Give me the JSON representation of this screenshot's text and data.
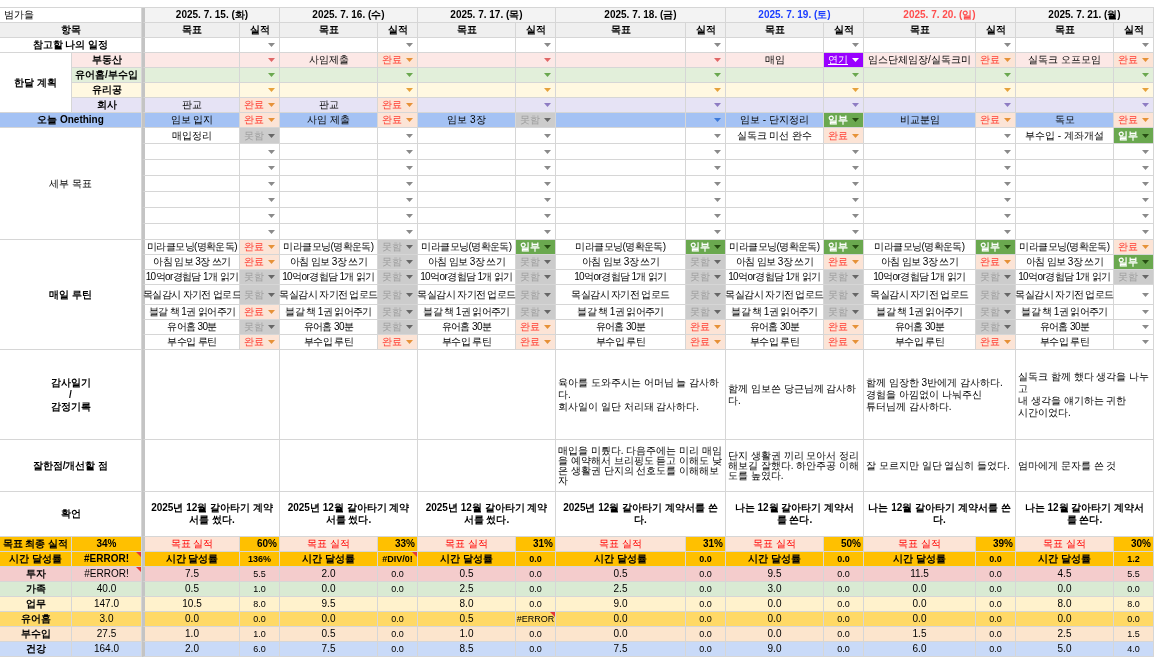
{
  "sheet": {
    "title": "범가을",
    "item_header": "항목",
    "reference_label": "참고할 나의 일정",
    "monthly_label": "한달 계획",
    "onething_label": "오늘 Onething",
    "details_label": "세부 목표",
    "routine_label": "매일 루틴",
    "gratitude_label": "감사일기\n/\n감정기록",
    "review_label": "잘한점/개선할 점",
    "affirmation_label": "확언"
  },
  "monthly_categories": [
    {
      "label": "부동산",
      "color": "#fce8e6",
      "arrow": {
        "color": "#e06666"
      }
    },
    {
      "label": "유어홈/부수입",
      "color": "#e2efda",
      "arrow": {
        "color": "#6aa84f"
      }
    },
    {
      "label": "유리공",
      "color": "#fff8e1",
      "arrow": {
        "color": "#e6a23c"
      }
    },
    {
      "label": "회사",
      "color": "#e6e3f5",
      "arrow": {
        "color": "#8e7cc3"
      }
    }
  ],
  "summary": {
    "rate_label": "목표 최종 실적",
    "rate": "34%",
    "time_label": "시간 달성률",
    "time_rate": "#ERROR!",
    "time_note": true
  },
  "summary_categories": [
    {
      "label": "투자",
      "color": "#f4cccc",
      "total": "#ERROR!",
      "note": true
    },
    {
      "label": "가족",
      "color": "#d9ead3",
      "total": "40.0",
      "note": false
    },
    {
      "label": "업무",
      "color": "#fff2cc",
      "total": "147.0",
      "note": false
    },
    {
      "label": "유어홈",
      "color": "#ffd966",
      "total": "3.0",
      "note": false
    },
    {
      "label": "부수입",
      "color": "#fce5cd",
      "total": "27.5",
      "note": false
    },
    {
      "label": "건강",
      "color": "#c9daf8",
      "total": "164.0",
      "note": false
    }
  ],
  "days": [
    {
      "date": "2025. 7. 15. (화)",
      "color": "#000000",
      "goal_header": "목표",
      "result_header": "실적",
      "reference": {
        "result": {
          "kind": "empty"
        }
      },
      "monthly": [
        {
          "result": {
            "kind": "empty"
          }
        },
        {
          "result": {
            "kind": "empty"
          }
        },
        {
          "result": {
            "kind": "empty"
          }
        },
        {
          "goal": "판교",
          "result": {
            "kind": "done",
            "label": "완료"
          }
        }
      ],
      "onething": {
        "goal": "임보 입지",
        "result": {
          "kind": "done",
          "label": "완료"
        }
      },
      "details": [
        {
          "goal": "매입정리",
          "result": {
            "kind": "fail",
            "label": "못함"
          }
        },
        {
          "result": {
            "kind": "empty"
          }
        },
        {
          "result": {
            "kind": "empty"
          }
        },
        {
          "result": {
            "kind": "empty"
          }
        },
        {
          "result": {
            "kind": "empty"
          }
        },
        {
          "result": {
            "kind": "empty"
          }
        },
        {
          "result": {
            "kind": "empty"
          }
        }
      ],
      "routine": [
        {
          "goal": "미라클모닝(명확운독)",
          "result": {
            "kind": "done",
            "label": "완료"
          }
        },
        {
          "goal": "아침 임보 3장 쓰기",
          "result": {
            "kind": "done",
            "label": "완료"
          }
        },
        {
          "goal": "10억or경험담 1개 읽기",
          "result": {
            "kind": "fail",
            "label": "못함"
          }
        },
        {
          "goal": "목실감시 자기전 업로드",
          "result": {
            "kind": "fail",
            "label": "못함"
          }
        },
        {
          "goal": "블갈 책 1권 읽어주기",
          "result": {
            "kind": "done",
            "label": "완료"
          }
        },
        {
          "goal": "유어홈 30분",
          "result": {
            "kind": "fail",
            "label": "못함"
          }
        },
        {
          "goal": "부수입 루틴",
          "result": {
            "kind": "done",
            "label": "완료"
          }
        }
      ],
      "affirmation": "2025년 12월 갈아타기 계약서를 썼다.",
      "rate_label": "목표 실적",
      "rate": "60%",
      "time_label": "시간 달성률",
      "time_rate": "136%",
      "time_note": false,
      "hours": [
        {
          "goal": "7.5",
          "result": "5.5",
          "note": false
        },
        {
          "goal": "0.5",
          "result": "1.0",
          "note": false
        },
        {
          "goal": "10.5",
          "result": "8.0",
          "note": false
        },
        {
          "goal": "0.0",
          "result": "0.0",
          "note": false
        },
        {
          "goal": "1.0",
          "result": "1.0",
          "note": false
        },
        {
          "goal": "2.0",
          "result": "6.0",
          "note": false
        }
      ]
    },
    {
      "date": "2025. 7. 16. (수)",
      "color": "#000000",
      "goal_header": "목표",
      "result_header": "실적",
      "reference": {
        "result": {
          "kind": "empty"
        }
      },
      "monthly": [
        {
          "goal": "사임제출",
          "result": {
            "kind": "done",
            "label": "완료"
          }
        },
        {
          "result": {
            "kind": "empty"
          }
        },
        {
          "result": {
            "kind": "empty"
          }
        },
        {
          "goal": "판교",
          "result": {
            "kind": "done",
            "label": "완료"
          }
        }
      ],
      "onething": {
        "goal": "사임 제출",
        "result": {
          "kind": "done",
          "label": "완료"
        }
      },
      "details": [
        {
          "result": {
            "kind": "empty"
          }
        },
        {
          "result": {
            "kind": "empty"
          }
        },
        {
          "result": {
            "kind": "empty"
          }
        },
        {
          "result": {
            "kind": "empty"
          }
        },
        {
          "result": {
            "kind": "empty"
          }
        },
        {
          "result": {
            "kind": "empty"
          }
        },
        {
          "result": {
            "kind": "empty"
          }
        }
      ],
      "routine": [
        {
          "goal": "미라클모닝(명확운독)",
          "result": {
            "kind": "fail",
            "label": "못함"
          }
        },
        {
          "goal": "아침 임보 3장 쓰기",
          "result": {
            "kind": "fail",
            "label": "못함"
          }
        },
        {
          "goal": "10억or경험담 1개 읽기",
          "result": {
            "kind": "fail",
            "label": "못함"
          }
        },
        {
          "goal": "목실감시 자기전 업로드",
          "result": {
            "kind": "fail",
            "label": "못함"
          }
        },
        {
          "goal": "블갈 책 1권 읽어주기",
          "result": {
            "kind": "fail",
            "label": "못함"
          }
        },
        {
          "goal": "유어홈 30분",
          "result": {
            "kind": "fail",
            "label": "못함"
          }
        },
        {
          "goal": "부수입 루틴",
          "result": {
            "kind": "done",
            "label": "완료"
          }
        }
      ],
      "affirmation": "2025년 12월 갈아타기 계약서를 썼다.",
      "rate_label": "목표 실적",
      "rate": "33%",
      "time_label": "시간 달성률",
      "time_rate": "#DIV/0!",
      "time_note": true,
      "hours": [
        {
          "goal": "2.0",
          "result": "0.0",
          "note": false
        },
        {
          "goal": "0.0",
          "result": "0.0",
          "note": false
        },
        {
          "goal": "9.5",
          "note": false
        },
        {
          "goal": "0.0",
          "result": "0.0",
          "note": false
        },
        {
          "goal": "0.5",
          "result": "0.0",
          "note": false
        },
        {
          "goal": "7.5",
          "result": "0.0",
          "note": false
        }
      ]
    },
    {
      "date": "2025. 7. 17. (목)",
      "color": "#000000",
      "goal_header": "목표",
      "result_header": "실적",
      "reference": {
        "result": {
          "kind": "empty"
        }
      },
      "monthly": [
        {
          "result": {
            "kind": "empty"
          }
        },
        {
          "result": {
            "kind": "empty"
          }
        },
        {
          "result": {
            "kind": "empty"
          }
        },
        {
          "result": {
            "kind": "empty"
          }
        }
      ],
      "onething": {
        "goal": "임보 3장",
        "result": {
          "kind": "fail",
          "label": "못함"
        }
      },
      "details": [
        {
          "result": {
            "kind": "empty"
          }
        },
        {
          "result": {
            "kind": "empty"
          }
        },
        {
          "result": {
            "kind": "empty"
          }
        },
        {
          "result": {
            "kind": "empty"
          }
        },
        {
          "result": {
            "kind": "empty"
          }
        },
        {
          "result": {
            "kind": "empty"
          }
        },
        {
          "result": {
            "kind": "empty"
          }
        }
      ],
      "routine": [
        {
          "goal": "미라클모닝(명확운독)",
          "result": {
            "kind": "partial",
            "label": "일부"
          }
        },
        {
          "goal": "아침 임보 3장 쓰기",
          "result": {
            "kind": "fail",
            "label": "못함"
          }
        },
        {
          "goal": "10억or경험담 1개 읽기",
          "result": {
            "kind": "fail",
            "label": "못함"
          }
        },
        {
          "goal": "목실감시 자기전 업로드",
          "result": {
            "kind": "fail",
            "label": "못함"
          }
        },
        {
          "goal": "블갈 책 1권 읽어주기",
          "result": {
            "kind": "fail",
            "label": "못함"
          }
        },
        {
          "goal": "유어홈 30분",
          "result": {
            "kind": "done",
            "label": "완료"
          }
        },
        {
          "goal": "부수입 루틴",
          "result": {
            "kind": "done",
            "label": "완료"
          }
        }
      ],
      "affirmation": "2025년 12월 갈아타기 계약서를 썼다.",
      "rate_label": "목표 실적",
      "rate": "31%",
      "time_label": "시간 달성률",
      "time_rate": "0.0",
      "time_note": false,
      "hours": [
        {
          "goal": "0.5",
          "result": "0.0",
          "note": false
        },
        {
          "goal": "2.5",
          "result": "0.0",
          "note": false
        },
        {
          "goal": "8.0",
          "result": "0.0",
          "note": false
        },
        {
          "goal": "0.5",
          "result": "#ERROR",
          "note": true
        },
        {
          "goal": "1.0",
          "result": "0.0",
          "note": false
        },
        {
          "goal": "8.5",
          "result": "0.0",
          "note": false
        }
      ]
    },
    {
      "date": "2025. 7. 18. (금)",
      "color": "#000000",
      "goal_header": "목표",
      "result_header": "실적",
      "reference": {
        "result": {
          "kind": "empty"
        }
      },
      "monthly": [
        {
          "result": {
            "kind": "empty"
          }
        },
        {
          "result": {
            "kind": "empty"
          }
        },
        {
          "result": {
            "kind": "empty"
          }
        },
        {
          "result": {
            "kind": "empty"
          }
        }
      ],
      "onething": {
        "result": {
          "kind": "empty"
        }
      },
      "details": [
        {
          "result": {
            "kind": "empty"
          }
        },
        {
          "result": {
            "kind": "empty"
          }
        },
        {
          "result": {
            "kind": "empty"
          }
        },
        {
          "result": {
            "kind": "empty"
          }
        },
        {
          "result": {
            "kind": "empty"
          }
        },
        {
          "result": {
            "kind": "empty"
          }
        },
        {
          "result": {
            "kind": "empty"
          }
        }
      ],
      "routine": [
        {
          "goal": "미라클모닝(명확운독)",
          "result": {
            "kind": "partial",
            "label": "일부"
          }
        },
        {
          "goal": "아침 임보 3장 쓰기",
          "result": {
            "kind": "fail",
            "label": "못함"
          }
        },
        {
          "goal": "10억or경험담 1개 읽기",
          "result": {
            "kind": "fail",
            "label": "못함"
          }
        },
        {
          "goal": "목실감시 자기전 업로드",
          "result": {
            "kind": "fail",
            "label": "못함"
          }
        },
        {
          "goal": "블갈 책 1권 읽어주기",
          "result": {
            "kind": "fail",
            "label": "못함"
          }
        },
        {
          "goal": "유어홈 30분",
          "result": {
            "kind": "done",
            "label": "완료"
          }
        },
        {
          "goal": "부수입 루틴",
          "result": {
            "kind": "done",
            "label": "완료"
          }
        }
      ],
      "gratitude": "육아를 도와주시는 어머님 늘 감사하다.\n회사일이 일단 처리돼 감사하다.",
      "review": "매입을 미뤘다. 다음주에는 미리 매임을 예약해서 브리핑도 듣고 이해도 낮은 생활권 단지의 선호도를 이해해보자",
      "affirmation": "2025년 12월 갈아타기 계약서를 쓴다.",
      "rate_label": "목표 실적",
      "rate": "31%",
      "time_label": "시간 달성률",
      "time_rate": "0.0",
      "time_note": false,
      "hours": [
        {
          "goal": "0.5",
          "result": "0.0",
          "note": false
        },
        {
          "goal": "2.5",
          "result": "0.0",
          "note": false
        },
        {
          "goal": "9.0",
          "result": "0.0",
          "note": false
        },
        {
          "goal": "0.0",
          "result": "0.0",
          "note": false
        },
        {
          "goal": "0.0",
          "result": "0.0",
          "note": false
        },
        {
          "goal": "7.5",
          "result": "0.0",
          "note": false
        }
      ]
    },
    {
      "date": "2025. 7. 19. (토)",
      "color": "#1a3cff",
      "goal_header": "목표",
      "result_header": "실적",
      "reference": {
        "result": {
          "kind": "empty"
        }
      },
      "monthly": [
        {
          "goal": "매임",
          "result": {
            "kind": "postponed",
            "label": "연기"
          }
        },
        {
          "result": {
            "kind": "empty"
          }
        },
        {
          "result": {
            "kind": "empty"
          }
        },
        {
          "result": {
            "kind": "empty"
          }
        }
      ],
      "onething": {
        "goal": "임보 - 단지정리",
        "result": {
          "kind": "partial",
          "label": "일부"
        }
      },
      "details": [
        {
          "goal": "실독크 미선 완수",
          "result": {
            "kind": "done",
            "label": "완료"
          }
        },
        {
          "result": {
            "kind": "empty"
          }
        },
        {
          "result": {
            "kind": "empty"
          }
        },
        {
          "result": {
            "kind": "empty"
          }
        },
        {
          "result": {
            "kind": "empty"
          }
        },
        {
          "result": {
            "kind": "empty"
          }
        },
        {
          "result": {
            "kind": "empty"
          }
        }
      ],
      "routine": [
        {
          "goal": "미라클모닝(명확운독)",
          "result": {
            "kind": "partial",
            "label": "일부"
          }
        },
        {
          "goal": "아침 임보 3장 쓰기",
          "result": {
            "kind": "done",
            "label": "완료"
          }
        },
        {
          "goal": "10억or경험담 1개 읽기",
          "result": {
            "kind": "fail",
            "label": "못함"
          }
        },
        {
          "goal": "목실감시 자기전 업로드",
          "result": {
            "kind": "fail",
            "label": "못함"
          }
        },
        {
          "goal": "블갈 책 1권 읽어주기",
          "result": {
            "kind": "fail",
            "label": "못함"
          }
        },
        {
          "goal": "유어홈 30분",
          "result": {
            "kind": "done",
            "label": "완료"
          }
        },
        {
          "goal": "부수입 루틴",
          "result": {
            "kind": "done",
            "label": "완료"
          }
        }
      ],
      "gratitude": "함께 임보쓴 당근님께 감사하다.",
      "review": "단지 생활권 끼리 모아서 정리해보길 잘했다. 하안주공 이해도를 높였다.",
      "affirmation": "나는 12월 갈아타기 계약서를 쓴다.",
      "rate_label": "목표 실적",
      "rate": "50%",
      "time_label": "시간 달성률",
      "time_rate": "0.0",
      "time_note": false,
      "hours": [
        {
          "goal": "9.5",
          "result": "0.0",
          "note": false
        },
        {
          "goal": "3.0",
          "result": "0.0",
          "note": false
        },
        {
          "goal": "0.0",
          "result": "0.0",
          "note": false
        },
        {
          "goal": "0.0",
          "result": "0.0",
          "note": false
        },
        {
          "goal": "0.0",
          "result": "0.0",
          "note": false
        },
        {
          "goal": "9.0",
          "result": "0.0",
          "note": false
        }
      ]
    },
    {
      "date": "2025. 7. 20. (일)",
      "color": "#ff4d4d",
      "goal_header": "목표",
      "result_header": "실적",
      "reference": {
        "result": {
          "kind": "empty"
        }
      },
      "monthly": [
        {
          "goal": "임스단체임장/실독크미",
          "result": {
            "kind": "done",
            "label": "완료"
          }
        },
        {
          "result": {
            "kind": "empty"
          }
        },
        {
          "result": {
            "kind": "empty"
          }
        },
        {
          "result": {
            "kind": "empty"
          }
        }
      ],
      "onething": {
        "goal": "비교분임",
        "result": {
          "kind": "done",
          "label": "완료"
        }
      },
      "details": [
        {
          "result": {
            "kind": "empty"
          }
        },
        {
          "result": {
            "kind": "empty"
          }
        },
        {
          "result": {
            "kind": "empty"
          }
        },
        {
          "result": {
            "kind": "empty"
          }
        },
        {
          "result": {
            "kind": "empty"
          }
        },
        {
          "result": {
            "kind": "empty"
          }
        },
        {
          "result": {
            "kind": "empty"
          }
        }
      ],
      "routine": [
        {
          "goal": "미라클모닝(명확운독)",
          "result": {
            "kind": "partial",
            "label": "일부"
          }
        },
        {
          "goal": "아침 임보 3장 쓰기",
          "result": {
            "kind": "done",
            "label": "완료"
          }
        },
        {
          "goal": "10억or경험담 1개 읽기",
          "result": {
            "kind": "fail",
            "label": "못함"
          }
        },
        {
          "goal": "목실감시 자기전 업로드",
          "result": {
            "kind": "fail",
            "label": "못함"
          }
        },
        {
          "goal": "블갈 책 1권 읽어주기",
          "result": {
            "kind": "fail",
            "label": "못함"
          }
        },
        {
          "goal": "유어홈 30분",
          "result": {
            "kind": "fail",
            "label": "못함"
          }
        },
        {
          "goal": "부수입 루틴",
          "result": {
            "kind": "done",
            "label": "완료"
          }
        }
      ],
      "gratitude": "함께 임장한 3반에게 감사하다.\n경험을 아낌없이 나눠주신\n튜터님께 감사하다.",
      "review": "잘 모르지만 일단 열심히 들었다.",
      "affirmation": "나는 12월 갈아타기 계약서를 쓴다.",
      "rate_label": "목표 실적",
      "rate": "39%",
      "time_label": "시간 달성률",
      "time_rate": "0.0",
      "time_note": false,
      "hours": [
        {
          "goal": "11.5",
          "result": "0.0",
          "note": false
        },
        {
          "goal": "0.0",
          "result": "0.0",
          "note": false
        },
        {
          "goal": "0.0",
          "result": "0.0",
          "note": false
        },
        {
          "goal": "0.0",
          "result": "0.0",
          "note": false
        },
        {
          "goal": "1.5",
          "result": "0.0",
          "note": false
        },
        {
          "goal": "6.0",
          "result": "0.0",
          "note": false
        }
      ]
    },
    {
      "date": "2025. 7. 21. (월)",
      "color": "#000000",
      "goal_header": "목표",
      "result_header": "실적",
      "reference": {
        "result": {
          "kind": "empty"
        }
      },
      "monthly": [
        {
          "goal": "실독크 오프모임",
          "result": {
            "kind": "done",
            "label": "완료"
          }
        },
        {
          "result": {
            "kind": "empty"
          }
        },
        {
          "result": {
            "kind": "empty"
          }
        },
        {
          "result": {
            "kind": "empty"
          }
        }
      ],
      "onething": {
        "goal": "독모",
        "result": {
          "kind": "done",
          "label": "완료"
        }
      },
      "details": [
        {
          "goal": "부수입 - 계좌개설",
          "result": {
            "kind": "partial",
            "label": "일부"
          }
        },
        {
          "result": {
            "kind": "empty"
          }
        },
        {
          "result": {
            "kind": "empty"
          }
        },
        {
          "result": {
            "kind": "empty"
          }
        },
        {
          "result": {
            "kind": "empty"
          }
        },
        {
          "result": {
            "kind": "empty"
          }
        },
        {
          "result": {
            "kind": "empty"
          }
        }
      ],
      "routine": [
        {
          "goal": "미라클모닝(명확운독)",
          "result": {
            "kind": "done",
            "label": "완료"
          }
        },
        {
          "goal": "아침 임보 3장 쓰기",
          "result": {
            "kind": "partial",
            "label": "일부"
          }
        },
        {
          "goal": "10억or경험담 1개 읽기",
          "result": {
            "kind": "fail",
            "label": "못함"
          }
        },
        {
          "goal": "목실감시 자기전 업로드",
          "result": {
            "kind": "empty"
          }
        },
        {
          "goal": "블갈 책 1권 읽어주기",
          "result": {
            "kind": "empty"
          }
        },
        {
          "goal": "유어홈 30분",
          "result": {
            "kind": "empty"
          }
        },
        {
          "goal": "부수입 루틴",
          "result": {
            "kind": "empty"
          }
        }
      ],
      "gratitude": "실독크 함께 했다 생각을 나누고\n내 생각을 얘기하는 귀한\n시간이었다.",
      "review": "엄마에게 문자를 쓴 것",
      "affirmation": "나는 12월 갈아타기 계약서를 쓴다.",
      "rate_label": "목표 실적",
      "rate": "30%",
      "time_label": "시간 달성률",
      "time_rate": "1.2",
      "time_note": false,
      "hours": [
        {
          "goal": "4.5",
          "result": "5.5",
          "note": false
        },
        {
          "goal": "0.0",
          "result": "0.0",
          "note": false
        },
        {
          "goal": "8.0",
          "result": "8.0",
          "note": false
        },
        {
          "goal": "0.0",
          "result": "0.0",
          "note": false
        },
        {
          "goal": "2.5",
          "result": "1.5",
          "note": false
        },
        {
          "goal": "5.0",
          "result": "4.0",
          "note": false
        }
      ]
    }
  ]
}
